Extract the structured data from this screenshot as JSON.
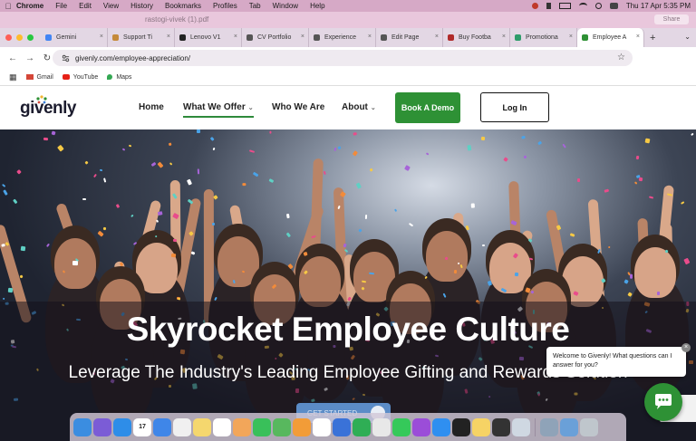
{
  "menubar": {
    "app": "Chrome",
    "items": [
      "File",
      "Edit",
      "View",
      "History",
      "Bookmarks",
      "Profiles",
      "Tab",
      "Window",
      "Help"
    ],
    "datetime": "Thu 17 Apr  5:35 PM"
  },
  "background_window": {
    "title": "rastogi-vivek (1).pdf",
    "badge": "Share"
  },
  "tabs": [
    {
      "label": "Gemini",
      "color": "#4285f4"
    },
    {
      "label": "Support Ti",
      "color": "#c58a3a"
    },
    {
      "label": "Lenovo V1",
      "color": "#222222"
    },
    {
      "label": "CV Portfolio",
      "color": "#555555"
    },
    {
      "label": "Experience",
      "color": "#555555"
    },
    {
      "label": "Edit Page",
      "color": "#555555"
    },
    {
      "label": "Buy Footba",
      "color": "#b02a2a"
    },
    {
      "label": "Promotiona",
      "color": "#2e9c6a"
    },
    {
      "label": "Employee A",
      "color": "#2e9135",
      "active": true
    }
  ],
  "address": {
    "url": "givenly.com/employee-appreciation/"
  },
  "bookmarks": [
    {
      "label": "Gmail",
      "color": "#d44638"
    },
    {
      "label": "YouTube",
      "color": "#e62117"
    },
    {
      "label": "Maps",
      "color": "#34a853"
    }
  ],
  "site": {
    "logo": "givenly",
    "nav": [
      {
        "label": "Home",
        "dropdown": false
      },
      {
        "label": "What We Offer",
        "dropdown": true,
        "active": true
      },
      {
        "label": "Who We Are",
        "dropdown": false
      },
      {
        "label": "About",
        "dropdown": true
      }
    ],
    "demo_button": "Book A Demo",
    "login_button": "Log In",
    "accent": "#2e9135"
  },
  "hero": {
    "title": "Skyrocket Employee Culture",
    "subtitle": "Leverage The Industry's Leading Employee Gifting and Rewards Solution",
    "cta": "GET STARTED"
  },
  "chat": {
    "message": "Welcome to Givenly! What questions can I answer for you?"
  },
  "dock": {
    "apps": [
      "Finder",
      "Siri",
      "Safari",
      "Calendar",
      "Mail",
      "Reminders",
      "Notes",
      "Freeform",
      "Photos",
      "Messages",
      "Maps",
      "Pages",
      "Chrome",
      "Keynote",
      "Numbers",
      "Launchpad",
      "FaceTime",
      "Podcasts",
      "App Store",
      "TV",
      "Notes2",
      "Terminal",
      "Preview",
      "Utility",
      "Downloads",
      "Trash"
    ],
    "calendar_day": "17"
  }
}
